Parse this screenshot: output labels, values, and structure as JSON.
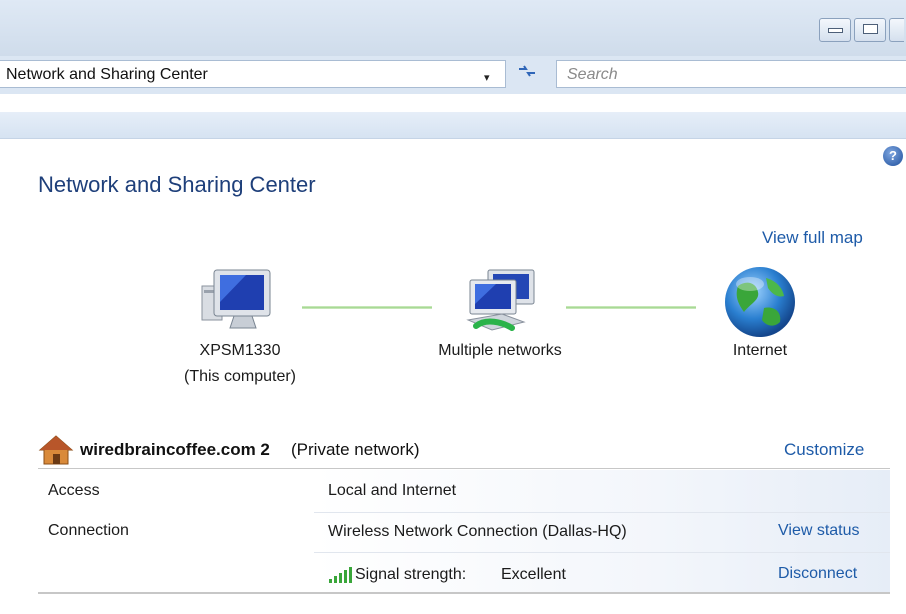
{
  "window": {
    "minimize_label": "minimize",
    "maximize_label": "maximize",
    "close_label": "close"
  },
  "address_bar": {
    "path": "Network and Sharing Center",
    "dropdown_glyph": "▾",
    "refresh_glyph": "↺"
  },
  "search": {
    "placeholder": "Search"
  },
  "page": {
    "title": "Network and Sharing Center",
    "help_glyph": "?",
    "view_full_map": "View full map"
  },
  "map": {
    "computer_name": "XPSM1330",
    "computer_sub": "(This computer)",
    "middle_label": "Multiple networks",
    "internet_label": "Internet"
  },
  "network": {
    "name": "wiredbraincoffee.com  2",
    "type": "(Private network)",
    "customize": "Customize",
    "rows": {
      "access_label": "Access",
      "access_value": "Local and Internet",
      "connection_label": "Connection",
      "connection_value": "Wireless Network Connection (Dallas-HQ)",
      "view_status": "View status",
      "signal_label": "Signal strength:",
      "signal_value": "Excellent",
      "disconnect": "Disconnect"
    }
  },
  "colors": {
    "link": "#1e5ba8",
    "title": "#1e3f7a",
    "connector": "#9fd48b"
  }
}
